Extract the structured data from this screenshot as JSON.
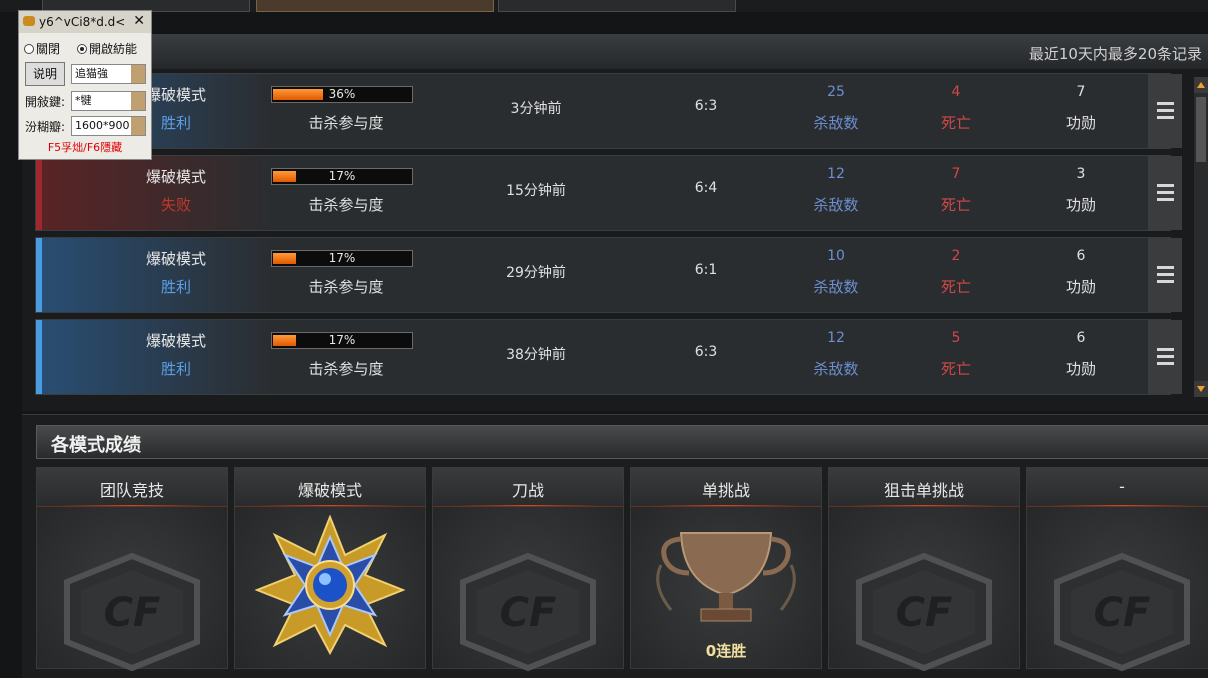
{
  "records": {
    "note": "最近10天内最多20条记录",
    "kill_part_label": "击杀参与度",
    "kills_label": "杀敌数",
    "deaths_label": "死亡",
    "merit_label": "功勋",
    "rows": [
      {
        "mode": "爆破模式",
        "result": "胜利",
        "outcome": "win",
        "kill_participation": 36,
        "pct": "36%",
        "time": "3分钟前",
        "score": "6:3",
        "kills": "25",
        "deaths": "4",
        "merit": "7"
      },
      {
        "mode": "爆破模式",
        "result": "失败",
        "outcome": "lose",
        "kill_participation": 17,
        "pct": "17%",
        "time": "15分钟前",
        "score": "6:4",
        "kills": "12",
        "deaths": "7",
        "merit": "3"
      },
      {
        "mode": "爆破模式",
        "result": "胜利",
        "outcome": "win",
        "kill_participation": 17,
        "pct": "17%",
        "time": "29分钟前",
        "score": "6:1",
        "kills": "10",
        "deaths": "2",
        "merit": "6"
      },
      {
        "mode": "爆破模式",
        "result": "胜利",
        "outcome": "win",
        "kill_participation": 17,
        "pct": "17%",
        "time": "38分钟前",
        "score": "6:3",
        "kills": "12",
        "deaths": "5",
        "merit": "6"
      }
    ]
  },
  "modes": {
    "title": "各模式成绩",
    "cards": [
      {
        "name": "团队竞技",
        "icon": "cf-emblem-icon"
      },
      {
        "name": "爆破模式",
        "icon": "rank-medal-icon"
      },
      {
        "name": "刀战",
        "icon": "cf-emblem-icon"
      },
      {
        "name": "单挑战",
        "icon": "trophy-icon",
        "streak": "0连胜"
      },
      {
        "name": "狙击单挑战",
        "icon": "cf-emblem-icon"
      },
      {
        "name": "-",
        "icon": "cf-emblem-icon"
      }
    ]
  },
  "overlay": {
    "title": "y6^vCi8*d.d<",
    "close": "✕",
    "radio_off": "關閉",
    "radio_on": "開啟紡能",
    "help_button": "说明",
    "combo_mode": "追猫強",
    "key_label": "開敍鍵:",
    "key_value": "*犍",
    "res_label": "汾糊瓣:",
    "res_value": "1600*900",
    "hint": "F5孚炪/F6隱藏"
  },
  "colors": {
    "win": "#4a9ce0",
    "lose": "#a0272b",
    "progress": "#f07a18",
    "kills": "#6d8fd0",
    "deaths": "#d04848"
  }
}
